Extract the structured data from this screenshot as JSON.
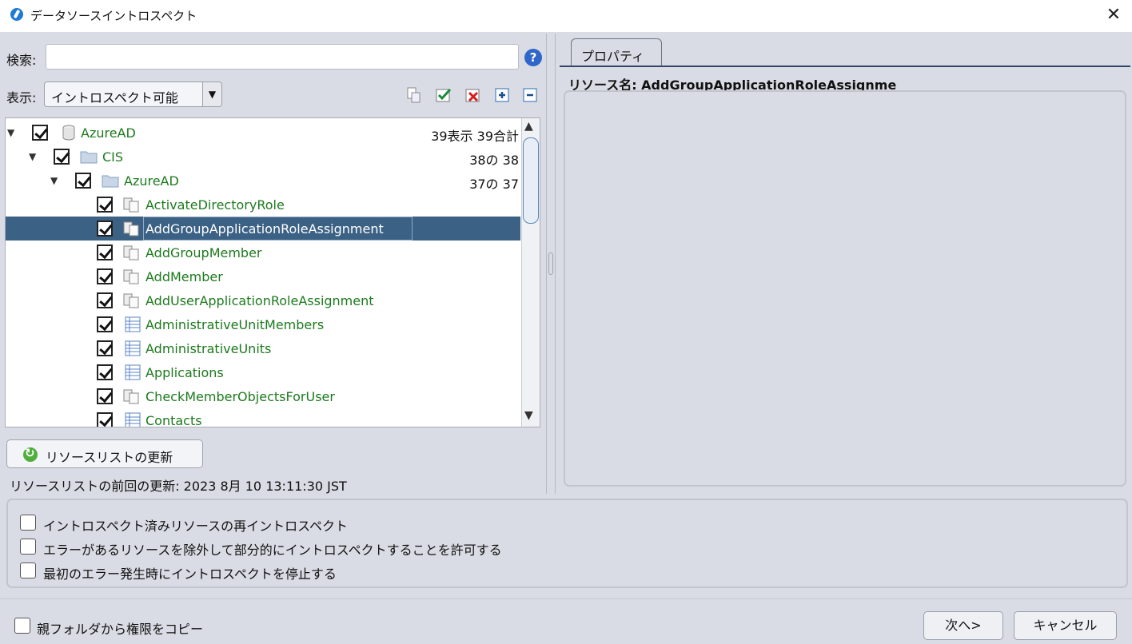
{
  "window": {
    "title": "データソースイントロスペクト",
    "close_label": "✕"
  },
  "search": {
    "label": "検索:",
    "value": "",
    "placeholder": "",
    "help_icon": "question-icon"
  },
  "view": {
    "label": "表示:",
    "selected": "イントロスペクト可能"
  },
  "toolbar": [
    "add-resource-icon",
    "check-all-icon",
    "uncheck-all-icon",
    "expand-all-icon",
    "collapse-all-icon"
  ],
  "tree": [
    {
      "label": "AzureAD",
      "count": "39表示 39合計",
      "icon": "database-icon",
      "level": 0,
      "expanded": true
    },
    {
      "label": "CIS",
      "count": "38の 38",
      "icon": "folder-icon",
      "level": 1,
      "expanded": true
    },
    {
      "label": "AzureAD",
      "count": "37の 37",
      "icon": "folder-icon",
      "level": 2,
      "expanded": true
    },
    {
      "label": "ActivateDirectoryRole",
      "icon": "procedure-icon",
      "level": 3
    },
    {
      "label": "AddGroupApplicationRoleAssignment",
      "icon": "procedure-icon",
      "level": 3,
      "selected": true
    },
    {
      "label": "AddGroupMember",
      "icon": "procedure-icon",
      "level": 3
    },
    {
      "label": "AddMember",
      "icon": "procedure-icon",
      "level": 3
    },
    {
      "label": "AddUserApplicationRoleAssignment",
      "icon": "procedure-icon",
      "level": 3
    },
    {
      "label": "AdministrativeUnitMembers",
      "icon": "table-icon",
      "level": 3
    },
    {
      "label": "AdministrativeUnits",
      "icon": "table-icon",
      "level": 3
    },
    {
      "label": "Applications",
      "icon": "table-icon",
      "level": 3
    },
    {
      "label": "CheckMemberObjectsForUser",
      "icon": "procedure-icon",
      "level": 3
    },
    {
      "label": "Contacts",
      "icon": "table-icon",
      "level": 3
    }
  ],
  "refresh": {
    "label": "リソースリストの更新",
    "last_update": "リソースリストの前回の更新: 2023 8月 10 13:11:30 JST"
  },
  "properties": {
    "tab_label": "プロパティ",
    "resource_name": "リソース名: AddGroupApplicationRoleAssignme"
  },
  "options": [
    "イントロスペクト済みリソースの再イントロスペクト",
    "エラーがあるリソースを除外して部分的にイントロスペクトすることを許可する",
    "最初のエラー発生時にイントロスペクトを停止する"
  ],
  "copy_permissions": "親フォルダから権限をコピー",
  "buttons": {
    "next": "次へ>",
    "cancel": "キャンセル"
  },
  "colors": {
    "tree_text": "#1d7a1d",
    "selection": "#3b6185"
  }
}
